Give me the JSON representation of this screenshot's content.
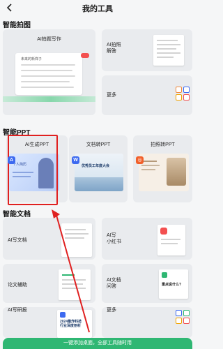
{
  "header": {
    "title": "我的工具",
    "back_icon": "chevron-left-icon"
  },
  "sections": {
    "photo": "智能拍图",
    "ppt": "智能PPT",
    "doc": "智能文档"
  },
  "photo_tools": {
    "ai_writing": "AI拍题写作",
    "ai_answer": "AI拍照\n解答",
    "more": "更多",
    "paper_heading": "未来的新样子"
  },
  "ppt_tools": {
    "ai_ppt": "AI生成PPT",
    "doc_to_ppt": "文档转PPT",
    "photo_to_ppt": "拍照转PPT",
    "ai_ppt_thumb_text": "个人简历",
    "doc_ppt_thumb_text": "优秀员工年度大会"
  },
  "doc_tools": {
    "ai_write_doc": "AI写文档",
    "ai_xiaohongshu": "AI写\n小红书",
    "paper_assist": "论文辅助",
    "ai_doc_qa": "AI文档\n问答",
    "ai_research": "AI写研报",
    "more": "更多",
    "qa_thumb_text": "重点说什么?",
    "research_thumb_text": "2024最炸科技\n行业深度剖析"
  },
  "bottom_bar": {
    "label": "一键添加桌面，全部工具随时用"
  },
  "colors": {
    "accent_green": "#2fb773",
    "highlight_red": "#e02020",
    "ppt_blue": "#3d6af0",
    "ppt_orange": "#f2602a"
  }
}
